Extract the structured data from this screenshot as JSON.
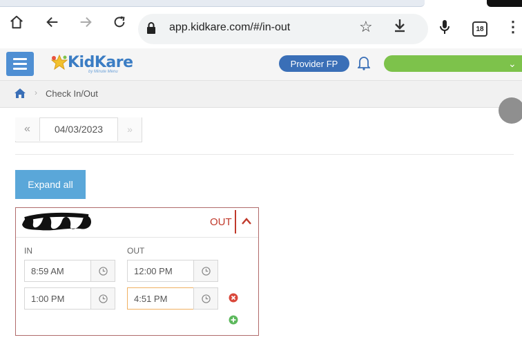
{
  "browser": {
    "url": "app.kidkare.com/#/in-out",
    "tab_count": "18"
  },
  "header": {
    "logo_text": "KidKare",
    "logo_subtext": "by Minute Menu",
    "provider_button": "Provider FP",
    "accent_color": "#4f8fd3",
    "green_select_color": "#7dc24b"
  },
  "breadcrumb": {
    "current": "Check In/Out"
  },
  "date_nav": {
    "prev": "«",
    "date": "04/03/2023",
    "next": "»"
  },
  "expand_button": "Expand all",
  "child_panel": {
    "status": "OUT",
    "in_label": "IN",
    "out_label": "OUT",
    "rows": [
      {
        "in": "8:59 AM",
        "out": "12:00 PM"
      },
      {
        "in": "1:00 PM",
        "out": "4:51 PM"
      }
    ],
    "status_color": "#c0392b"
  }
}
